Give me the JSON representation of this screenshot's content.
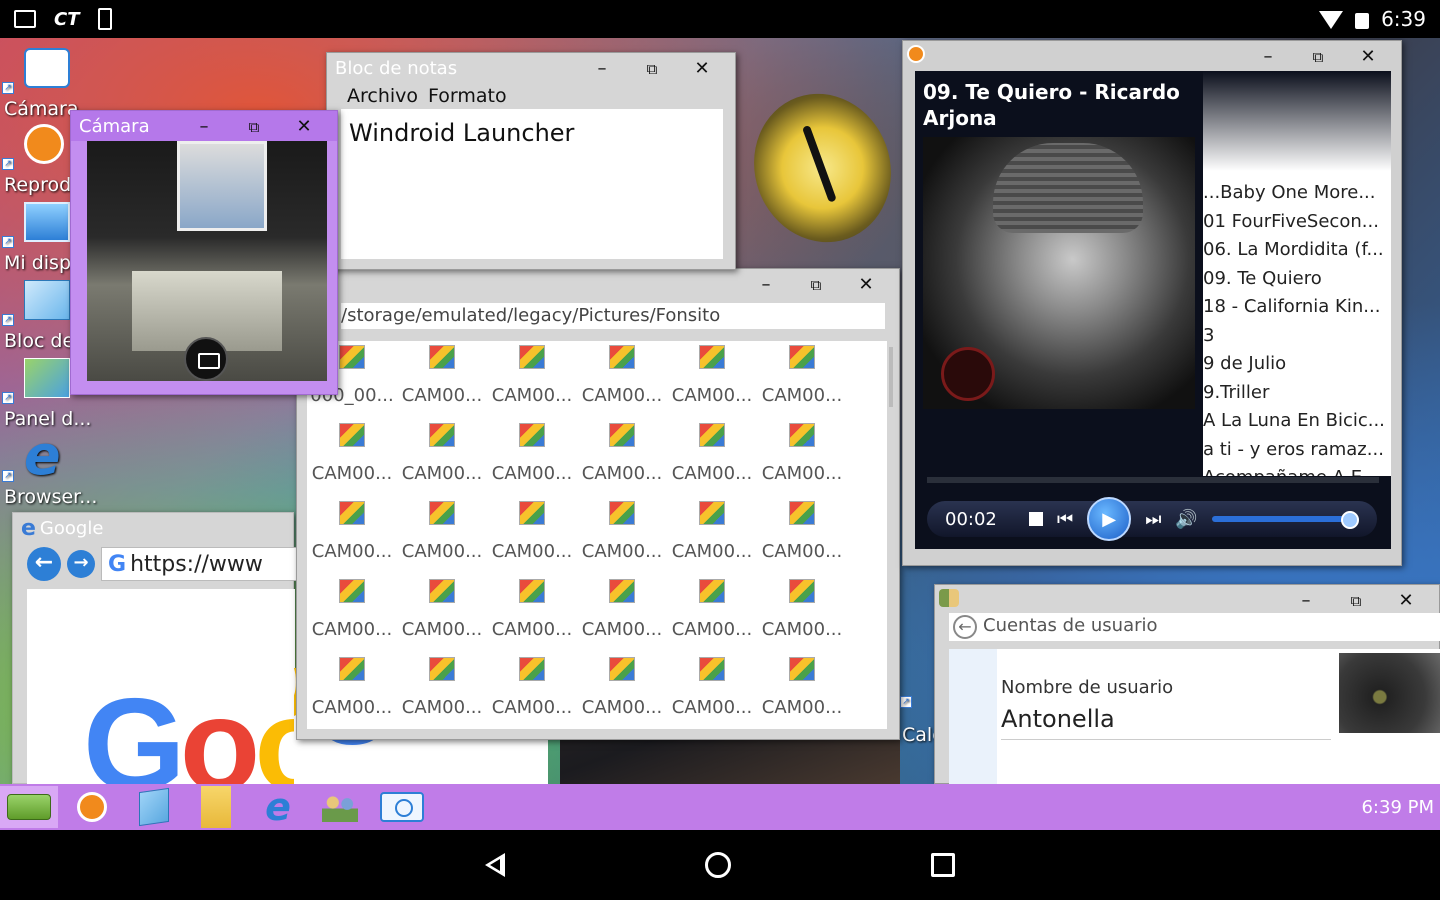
{
  "status_bar": {
    "carrier_label": "CT",
    "time": "6:39"
  },
  "desktop_icons": [
    {
      "label": "Cámara",
      "icon": "camera-icon"
    },
    {
      "label": "Reprod",
      "icon": "media-player-icon"
    },
    {
      "label": "Mi disp",
      "icon": "computer-icon"
    },
    {
      "label": "Bloc de",
      "icon": "notepad-icon"
    },
    {
      "label": "Panel d...",
      "icon": "control-panel-icon"
    },
    {
      "label": "Browser...",
      "icon": "browser-icon"
    },
    {
      "label": "Calc",
      "icon": "calculator-icon"
    }
  ],
  "camera_window": {
    "title": "Cámara"
  },
  "notepad_window": {
    "title": "Bloc de notas",
    "menu": [
      "Archivo",
      "Formato"
    ],
    "text": "Windroid Launcher"
  },
  "files_window": {
    "path": "/storage/emulated/legacy/Pictures/Fonsito",
    "first_file": "000_00...",
    "file_name": "CAM00..."
  },
  "player_window": {
    "song_title": "09. Te Quiero - Ricardo Arjona",
    "playlist": [
      "...Baby One More...",
      "01 FourFiveSecon...",
      "06. La Mordidita (f...",
      "09. Te Quiero",
      "18 - California Kin...",
      "3",
      "9 de Julio",
      "9.Triller",
      "A La Luna En Bicic...",
      "a ti - y eros ramaz...",
      "Acompañame A E..."
    ],
    "elapsed": "00:02",
    "controls": {
      "prev": "⏮",
      "next": "⏭",
      "volume": "🔊"
    },
    "volume_level": 0.85
  },
  "accounts_window": {
    "title": "Cuentas de usuario",
    "username_label": "Nombre de usuario",
    "username": "Antonella"
  },
  "browser_window": {
    "title": "Google",
    "url": "https://www",
    "logo_text": "Google"
  },
  "taskbar": {
    "items": [
      "start-icon",
      "media-player-icon",
      "notepad-icon",
      "folder-icon",
      "browser-icon",
      "users-icon",
      "camera-icon"
    ],
    "clock": "6:39 PM"
  },
  "colors": {
    "taskbar": "#c07ce8",
    "camera_frame": "#c38ef0",
    "accent_blue": "#2d7fd6"
  }
}
